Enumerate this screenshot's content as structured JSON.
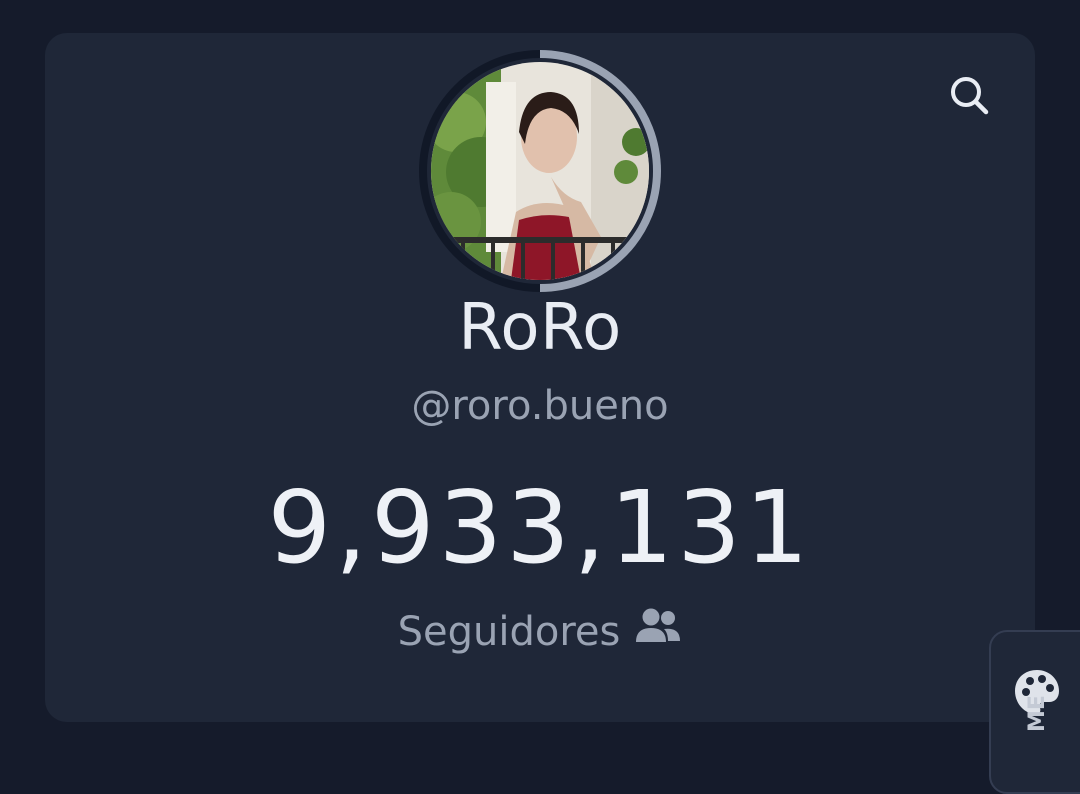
{
  "profile": {
    "name": "RoRo",
    "handle": "@roro.bueno",
    "follower_count": "9,933,131",
    "followers_label": "Seguidores",
    "avatar_icon": "profile-photo",
    "ring_progress": 0.5
  },
  "toolbar": {
    "search_icon": "search-icon"
  },
  "theme_tab": {
    "icon": "palette-icon",
    "label": "ME"
  },
  "colors": {
    "background": "#151b2b",
    "card": "#1f2738",
    "text_primary": "#e9edf4",
    "text_secondary": "#9aa3b3",
    "ring_active": "#9aa3b3",
    "ring_track": "#111827"
  }
}
